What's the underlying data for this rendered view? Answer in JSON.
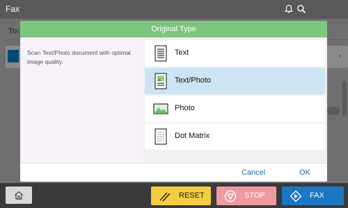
{
  "app": {
    "title": "Fax",
    "header_icons": [
      "bell-icon",
      "search-icon"
    ]
  },
  "background": {
    "to_label": "To:"
  },
  "dialog": {
    "title": "Original Type",
    "description": "Scan Text/Photo document with optimal image quality.",
    "options": [
      {
        "label": "Text",
        "icon": "text-document-icon",
        "selected": false
      },
      {
        "label": "Text/Photo",
        "icon": "text-photo-document-icon",
        "selected": true
      },
      {
        "label": "Photo",
        "icon": "photo-icon",
        "selected": false
      },
      {
        "label": "Dot Matrix",
        "icon": "dot-matrix-document-icon",
        "selected": false
      }
    ],
    "cancel_label": "Cancel",
    "ok_label": "OK"
  },
  "bottom": {
    "home_icon": "home-icon",
    "reset_label": "RESET",
    "stop_label": "STOP",
    "fax_label": "FAX"
  },
  "colors": {
    "header_green": "#7ec57f",
    "selected_blue": "#cde4f2",
    "reset_yellow": "#f6cc41",
    "stop_pink": "#ef9aa2",
    "fax_blue": "#1b76c4",
    "link_blue": "#1d6fb0"
  }
}
